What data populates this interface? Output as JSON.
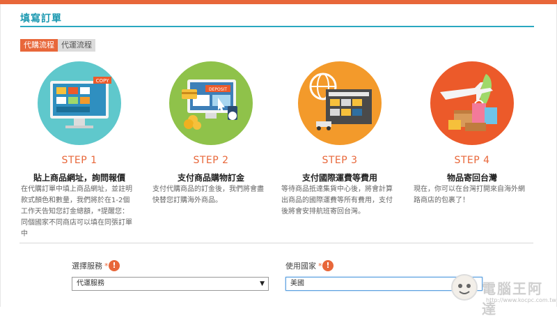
{
  "header": {
    "title": "填寫訂單"
  },
  "tabs": [
    {
      "label": "代購流程",
      "active": true
    },
    {
      "label": "代運流程",
      "active": false
    }
  ],
  "steps": [
    {
      "number": "STEP 1",
      "title": "貼上商品網址，詢問報價",
      "desc": "在代購訂單中填上商品網址，並註明款式顏色和數量，我們將於在1-2個工作天告知您訂金總額，*提醒您：同個國家不同商店可以填在同張訂單中",
      "icon": "monitor-shop-icon",
      "color": "#5fc8cc"
    },
    {
      "number": "STEP 2",
      "title": "支付商品購物訂金",
      "desc": "支付代購商品的訂金後，我們將會盡快替您訂購海外商品。",
      "icon": "deposit-payment-icon",
      "color": "#8fc24a"
    },
    {
      "number": "STEP 3",
      "title": "支付國際運費等費用",
      "desc": "等待商品抵達集貨中心後，將會計算出商品的國際運費等所有費用，支付後將會安排航班寄回台灣。",
      "icon": "warehouse-shipping-icon",
      "color": "#f39a2b"
    },
    {
      "number": "STEP 4",
      "title": "物品寄回台灣",
      "desc": "現在，你可以在台灣打開來自海外網路商店的包裹了！",
      "icon": "airplane-parcel-icon",
      "color": "#ec5a2a"
    }
  ],
  "form": {
    "service": {
      "label": "選擇服務",
      "required": "*",
      "value": "代運服務",
      "arrow": "▼"
    },
    "country": {
      "label": "使用國家",
      "required": "*",
      "value": "美國"
    },
    "warn_glyph": "!"
  },
  "watermark": {
    "text": "電腦王阿達",
    "url": "http://www.kocpc.com.tw"
  },
  "colors": {
    "accent": "#e8673a",
    "title": "#1a98b0"
  }
}
